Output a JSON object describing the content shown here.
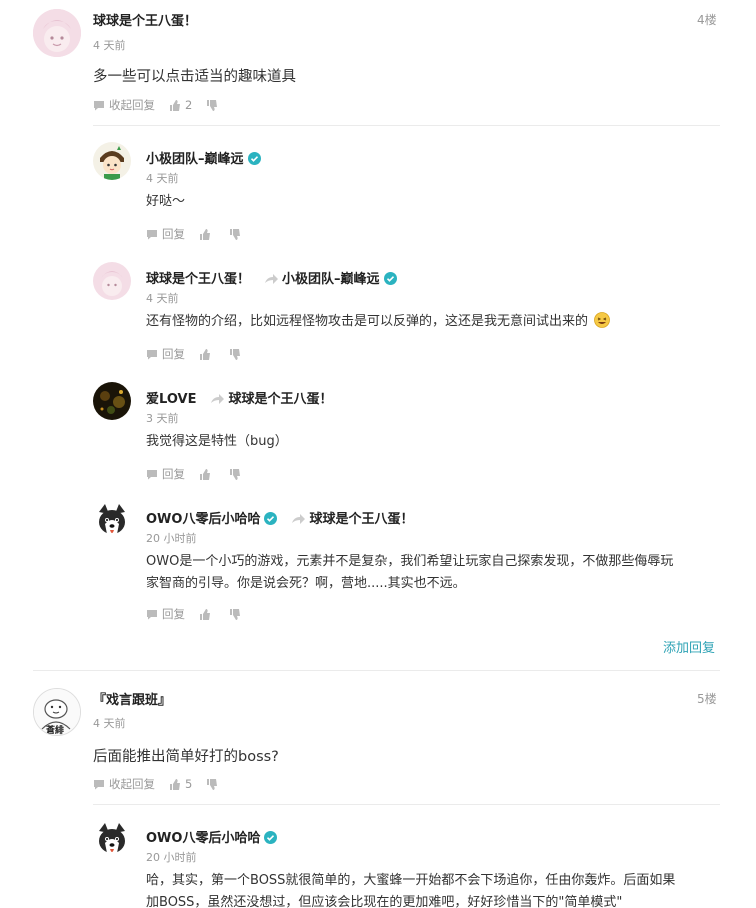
{
  "comments": [
    {
      "user": "球球是个王八蛋！",
      "time": "4 天前",
      "floor": "4楼",
      "content": "多一些可以点击适当的趣味道具",
      "collapse_label": "收起回复",
      "likes": "2",
      "replies": [
        {
          "user": "小极团队–巅峰远",
          "time": "4 天前",
          "content": "好哒～",
          "reply_label": "回复"
        },
        {
          "user": "球球是个王八蛋！",
          "reply_to": "小极团队–巅峰远",
          "time": "4 天前",
          "content": "还有怪物的介绍，比如远程怪物攻击是可以反弹的，这还是我无意间试出来的",
          "reply_label": "回复"
        },
        {
          "user": "爱LOVE",
          "reply_to": "球球是个王八蛋！",
          "time": "3 天前",
          "content": "我觉得这是特性（bug）",
          "reply_label": "回复"
        },
        {
          "user": "OWO八零后小哈哈",
          "reply_to": "球球是个王八蛋！",
          "time": "20 小时前",
          "content_line1": "OWO是一个小巧的游戏，元素并不是复杂，我们希望让玩家自己探索发现，不做那些侮辱玩",
          "content_line2": "家智商的引导。你是说会死？啊，营地.....其实也不远。",
          "reply_label": "回复"
        }
      ],
      "add_reply_label": "添加回复"
    },
    {
      "user": "『戏言跟班』",
      "time": "4 天前",
      "floor": "5楼",
      "content": "后面能推出简单好打的boss?",
      "collapse_label": "收起回复",
      "likes": "5",
      "avatar_text": "蒼緋",
      "replies": [
        {
          "user": "OWO八零后小哈哈",
          "time": "20 小时前",
          "content_line1": "哈，其实，第一个BOSS就很简单的，大蜜蜂一开始都不会下场追你，任由你轰炸。后面如果",
          "content_line2": "加BOSS，虽然还没想过，但应该会比现在的更加难吧，好好珍惜当下的\"简单模式\""
        }
      ]
    }
  ],
  "colors": {
    "verified": "#2bb3c0",
    "link": "#2fa3b5"
  }
}
